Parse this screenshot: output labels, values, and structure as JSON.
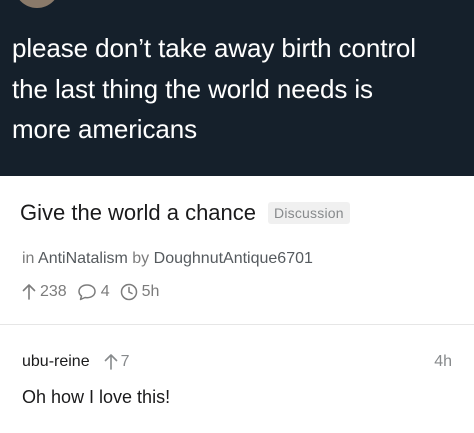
{
  "tweet": {
    "lines": [
      "please don’t take away birth control",
      "the last thing the world needs is",
      "more americans"
    ]
  },
  "post": {
    "title": "Give the world a chance",
    "flair": "Discussion",
    "meta": {
      "prefix_in": "in",
      "subreddit": "AntiNatalism",
      "prefix_by": "by",
      "author": "DoughnutAntique6701"
    },
    "stats": {
      "upvotes": "238",
      "comments": "4",
      "age": "5h"
    }
  },
  "comment": {
    "author": "ubu-reine",
    "votes": "7",
    "time": "4h",
    "body": "Oh how I love this!"
  },
  "icons": {
    "upvote": "arrow-up-icon",
    "comments": "comment-bubble-icon",
    "age": "clock-icon"
  }
}
